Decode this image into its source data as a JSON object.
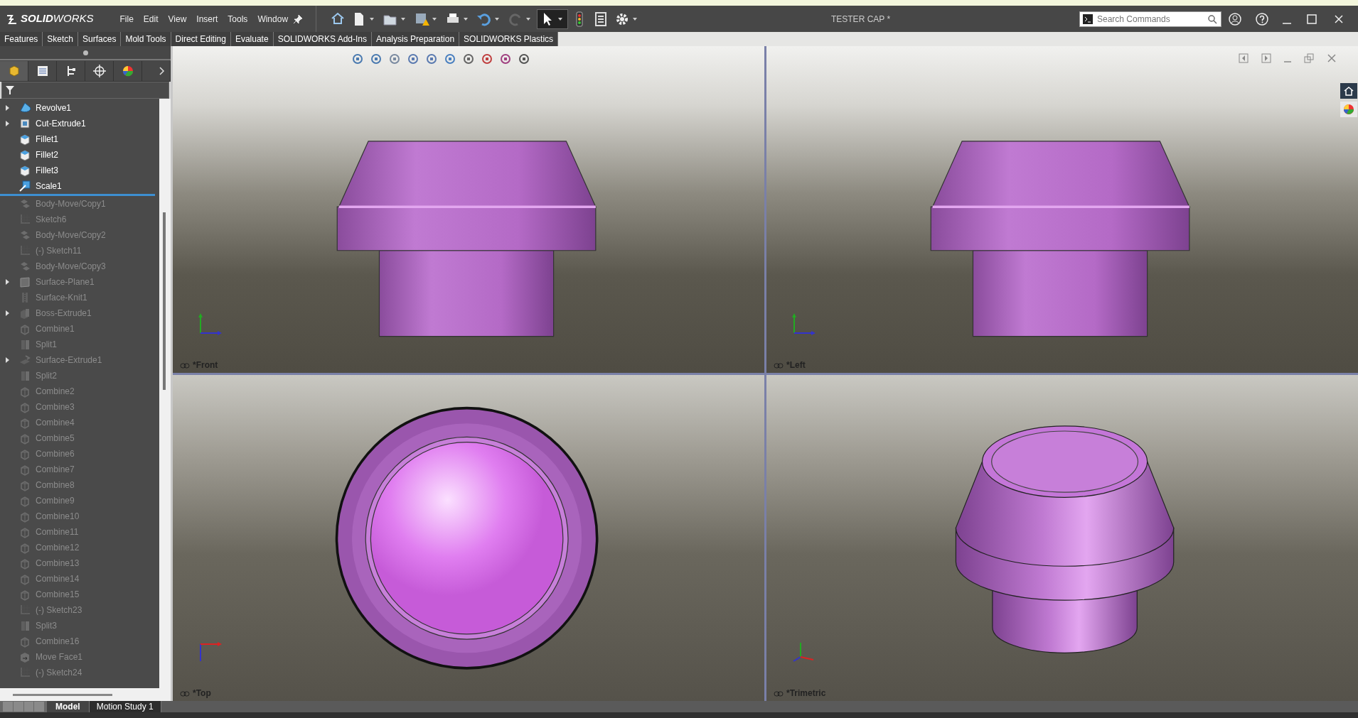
{
  "window": {
    "title": "TESTER CAP *"
  },
  "logo": "**SOLID**WORKS",
  "panel_tabs": [
    {
      "selected": true
    },
    {
      "selected": false
    },
    {
      "selected": false
    },
    {
      "selected": false
    },
    {
      "selected": false
    }
  ],
  "menu": [
    "File",
    "Edit",
    "View",
    "Insert",
    "Tools",
    "Window"
  ],
  "search": {
    "placeholder": "Search Commands"
  },
  "command_tabs": [
    "Features",
    "Sketch",
    "Surfaces",
    "Mold Tools",
    "Direct Editing",
    "Evaluate",
    "SOLIDWORKS Add-Ins",
    "Analysis Preparation",
    "SOLIDWORKS Plastics"
  ],
  "feature_tree": [
    {
      "name": "Revolve1",
      "kind": "revolve",
      "expandable": true,
      "rolled_back": false
    },
    {
      "name": "Cut-Extrude1",
      "kind": "cut",
      "expandable": true,
      "rolled_back": false
    },
    {
      "name": "Fillet1",
      "kind": "fillet",
      "expandable": false,
      "rolled_back": false
    },
    {
      "name": "Fillet2",
      "kind": "fillet",
      "expandable": false,
      "rolled_back": false
    },
    {
      "name": "Fillet3",
      "kind": "fillet",
      "expandable": false,
      "rolled_back": false
    },
    {
      "name": "Scale1",
      "kind": "scale",
      "expandable": false,
      "rolled_back": false
    },
    {
      "name": "Body-Move/Copy1",
      "kind": "move",
      "expandable": false,
      "rolled_back": true
    },
    {
      "name": "Sketch6",
      "kind": "sketch",
      "expandable": false,
      "rolled_back": true
    },
    {
      "name": "Body-Move/Copy2",
      "kind": "move",
      "expandable": false,
      "rolled_back": true
    },
    {
      "name": "(-) Sketch11",
      "kind": "sketch",
      "expandable": false,
      "rolled_back": true
    },
    {
      "name": "Body-Move/Copy3",
      "kind": "move",
      "expandable": false,
      "rolled_back": true
    },
    {
      "name": "Surface-Plane1",
      "kind": "plane",
      "expandable": true,
      "rolled_back": true
    },
    {
      "name": "Surface-Knit1",
      "kind": "knit",
      "expandable": false,
      "rolled_back": true
    },
    {
      "name": "Boss-Extrude1",
      "kind": "extrude",
      "expandable": true,
      "rolled_back": true
    },
    {
      "name": "Combine1",
      "kind": "combine",
      "expandable": false,
      "rolled_back": true
    },
    {
      "name": "Split1",
      "kind": "split",
      "expandable": false,
      "rolled_back": true
    },
    {
      "name": "Surface-Extrude1",
      "kind": "surface",
      "expandable": true,
      "rolled_back": true
    },
    {
      "name": "Split2",
      "kind": "split",
      "expandable": false,
      "rolled_back": true
    },
    {
      "name": "Combine2",
      "kind": "combine",
      "expandable": false,
      "rolled_back": true
    },
    {
      "name": "Combine3",
      "kind": "combine",
      "expandable": false,
      "rolled_back": true
    },
    {
      "name": "Combine4",
      "kind": "combine",
      "expandable": false,
      "rolled_back": true
    },
    {
      "name": "Combine5",
      "kind": "combine",
      "expandable": false,
      "rolled_back": true
    },
    {
      "name": "Combine6",
      "kind": "combine",
      "expandable": false,
      "rolled_back": true
    },
    {
      "name": "Combine7",
      "kind": "combine",
      "expandable": false,
      "rolled_back": true
    },
    {
      "name": "Combine8",
      "kind": "combine",
      "expandable": false,
      "rolled_back": true
    },
    {
      "name": "Combine9",
      "kind": "combine",
      "expandable": false,
      "rolled_back": true
    },
    {
      "name": "Combine10",
      "kind": "combine",
      "expandable": false,
      "rolled_back": true
    },
    {
      "name": "Combine11",
      "kind": "combine",
      "expandable": false,
      "rolled_back": true
    },
    {
      "name": "Combine12",
      "kind": "combine",
      "expandable": false,
      "rolled_back": true
    },
    {
      "name": "Combine13",
      "kind": "combine",
      "expandable": false,
      "rolled_back": true
    },
    {
      "name": "Combine14",
      "kind": "combine",
      "expandable": false,
      "rolled_back": true
    },
    {
      "name": "Combine15",
      "kind": "combine",
      "expandable": false,
      "rolled_back": true
    },
    {
      "name": "(-) Sketch23",
      "kind": "sketch",
      "expandable": false,
      "rolled_back": true
    },
    {
      "name": "Split3",
      "kind": "split",
      "expandable": false,
      "rolled_back": true
    },
    {
      "name": "Combine16",
      "kind": "combine",
      "expandable": false,
      "rolled_back": true
    },
    {
      "name": "Move Face1",
      "kind": "moveface",
      "expandable": false,
      "rolled_back": true
    },
    {
      "name": "(-) Sketch24",
      "kind": "sketch",
      "expandable": false,
      "rolled_back": true
    }
  ],
  "viewports": [
    {
      "label": "*Front",
      "kind": "side"
    },
    {
      "label": "*Left",
      "kind": "side"
    },
    {
      "label": "*Top",
      "kind": "top"
    },
    {
      "label": "*Trimetric",
      "kind": "iso"
    }
  ],
  "bottom_tabs": [
    {
      "label": "Model",
      "selected": true
    },
    {
      "label": "Motion Study 1",
      "selected": false
    }
  ]
}
